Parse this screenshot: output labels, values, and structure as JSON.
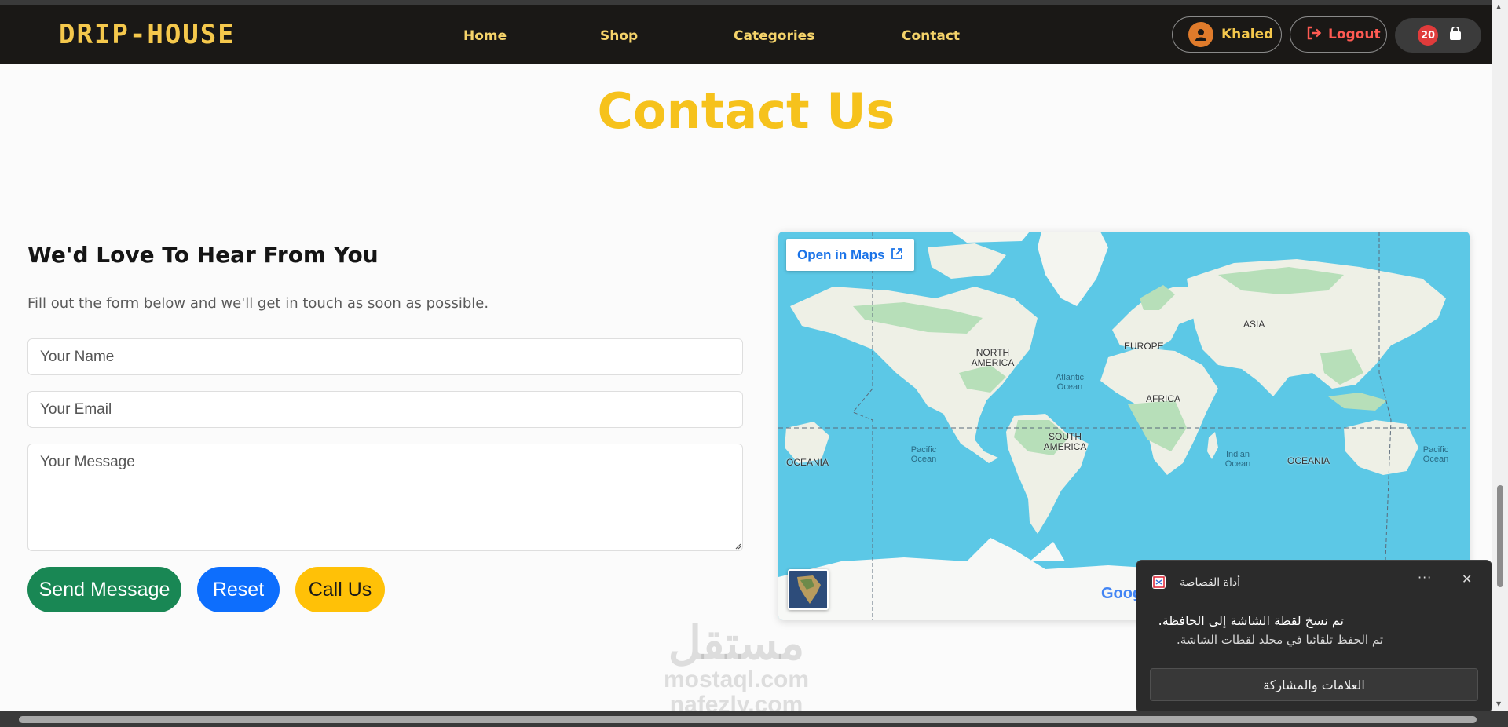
{
  "navbar": {
    "brand": "DRIP-HOUSE",
    "links": [
      "Home",
      "Shop",
      "Categories",
      "Contact"
    ],
    "user_name": "Khaled",
    "logout_label": "Logout",
    "cart_count": "20",
    "colors": {
      "background": "#1a1816",
      "accent": "#f5c84c",
      "logout": "#ff5a52",
      "badge": "#e03b3b"
    }
  },
  "page": {
    "title": "Contact Us"
  },
  "form": {
    "heading": "We'd Love To Hear From You",
    "subheading": "Fill out the form below and we'll get in touch as soon as possible.",
    "name_placeholder": "Your Name",
    "email_placeholder": "Your Email",
    "message_placeholder": "Your Message",
    "send_label": "Send Message",
    "reset_label": "Reset",
    "call_label": "Call Us",
    "colors": {
      "send": "#198754",
      "reset": "#0d6efd",
      "call": "#ffc107"
    }
  },
  "map": {
    "open_label": "Open in Maps",
    "continents": [
      "NORTH AMERICA",
      "SOUTH AMERICA",
      "EUROPE",
      "AFRICA",
      "ASIA",
      "OCEANIA",
      "OCEANIA"
    ],
    "oceans": [
      "Atlantic Ocean",
      "Pacific Ocean",
      "Indian Ocean",
      "Pacific Ocean"
    ],
    "logo_text": "Google",
    "colors": {
      "water": "#5cc8e6",
      "land": "#eef0e6",
      "vegetation": "#b7dfb9"
    }
  },
  "watermark": {
    "line1": "مستقل",
    "line2": "mostaql.com",
    "line3": "nafezly.com"
  },
  "toast": {
    "app_name": "أداة القصاصة",
    "line1": "تم نسخ لقطة الشاشة إلى الحافظة.",
    "line2": "تم الحفظ تلقائيا في مجلد لقطات الشاشة.",
    "action_label": "العلامات والمشاركة"
  }
}
